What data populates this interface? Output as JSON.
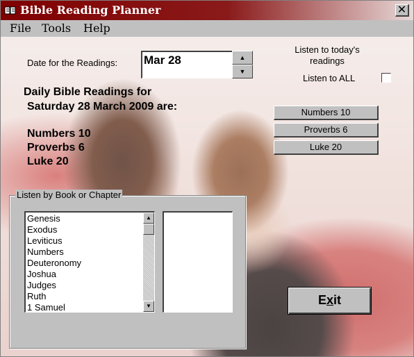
{
  "window": {
    "title": "Bible Reading Planner",
    "close_glyph": "✕"
  },
  "menu": [
    "File",
    "Tools",
    "Help"
  ],
  "date": {
    "label": "Date for the Readings:",
    "value": "Mar 28",
    "spin_up": "▲",
    "spin_down": "▼"
  },
  "listen": {
    "heading_line1": "Listen to today's",
    "heading_line2": "readings",
    "all_label": "Listen to ALL",
    "all_checked": false
  },
  "daily": {
    "heading_line1": "Daily Bible Readings for",
    "heading_line2": "Saturday 28 March 2009 are:",
    "readings": [
      "Numbers 10",
      "Proverbs 6",
      "Luke 20"
    ]
  },
  "reading_buttons": [
    "Numbers 10",
    "Proverbs 6",
    "Luke 20"
  ],
  "book_group": {
    "title": "Listen by Book or Chapter",
    "books": [
      "Genesis",
      "Exodus",
      "Leviticus",
      "Numbers",
      "Deuteronomy",
      "Joshua",
      "Judges",
      "Ruth",
      "1 Samuel"
    ],
    "scroll_up": "▲",
    "scroll_down": "▼"
  },
  "exit": {
    "label_pre": "E",
    "label_ul": "x",
    "label_post": "it"
  }
}
